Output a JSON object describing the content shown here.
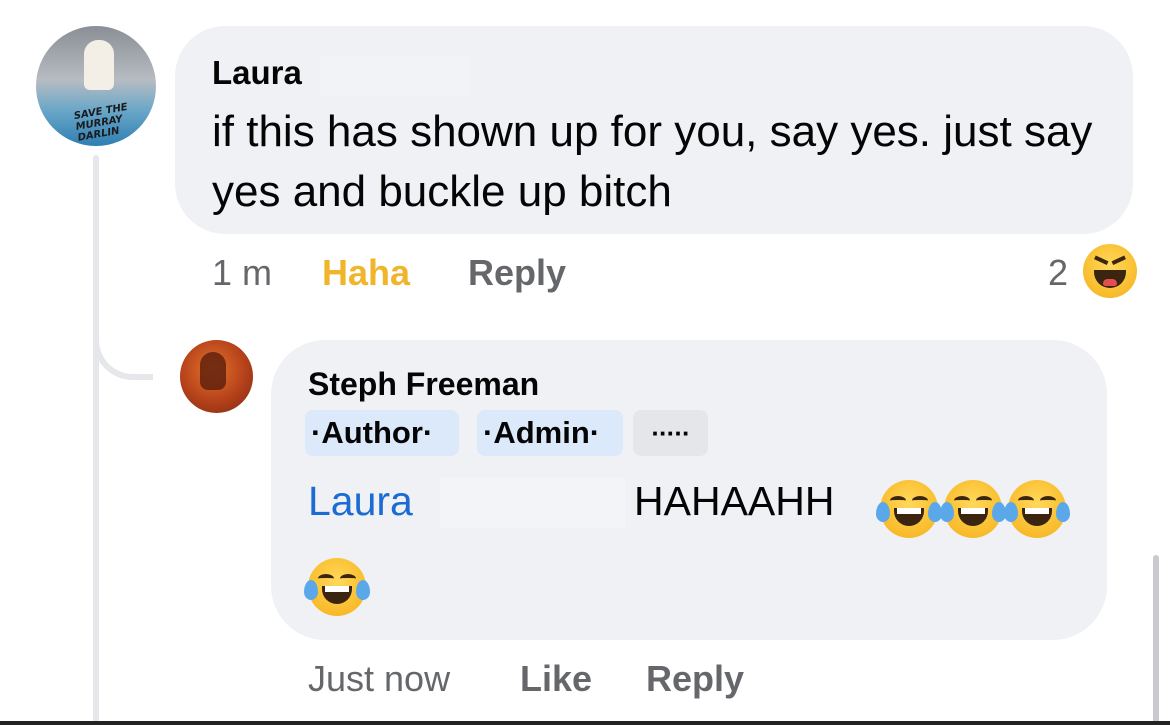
{
  "comment": {
    "author": "Laura",
    "avatar_text": "SAVE THE MURRAY DARLIN",
    "text": "if this has shown up for you, say yes. just say yes and buckle up bitch",
    "time": "1 m",
    "reaction_label": "Haha",
    "reply_label": "Reply",
    "reaction_count": "2",
    "reaction_icon": "laughing-emoji-icon",
    "reaction_color": "#f0b52a"
  },
  "reply": {
    "author": "Steph Freeman",
    "badges": [
      "·Author·",
      "·Admin·",
      "·····"
    ],
    "mention": "Laura",
    "text": "HAHAAHH",
    "emoji_icon": "tears-of-joy-emoji-icon",
    "emoji_count": 4,
    "time": "Just now",
    "like_label": "Like",
    "reply_label": "Reply",
    "mention_color": "#1b6bd3"
  }
}
